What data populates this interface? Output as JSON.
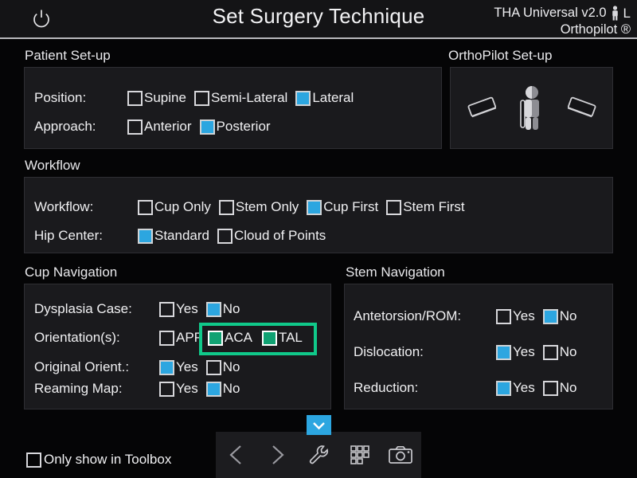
{
  "header": {
    "power_icon": "power-icon",
    "title": "Set Surgery Technique",
    "product": "THA Universal v2.0",
    "patient_icon": "person-icon",
    "laterality": "L",
    "brand": "Orthopilot ®"
  },
  "sections": {
    "patient_setup": {
      "label": "Patient Set-up",
      "rows": [
        {
          "label": "Position:",
          "options": [
            {
              "label": "Supine",
              "state": "unchecked"
            },
            {
              "label": "Semi-Lateral",
              "state": "unchecked"
            },
            {
              "label": "Lateral",
              "state": "checked-blue"
            }
          ]
        },
        {
          "label": "Approach:",
          "options": [
            {
              "label": "Anterior",
              "state": "unchecked"
            },
            {
              "label": "Posterior",
              "state": "checked-blue"
            }
          ]
        }
      ]
    },
    "orthopilot_setup": {
      "label": "OrthoPilot Set-up",
      "icons": [
        "camera-tilt-left-icon",
        "patient-figure-icon",
        "camera-tilt-right-icon"
      ]
    },
    "workflow": {
      "label": "Workflow",
      "rows": [
        {
          "label": "Workflow:",
          "options": [
            {
              "label": "Cup Only",
              "state": "unchecked"
            },
            {
              "label": "Stem Only",
              "state": "unchecked"
            },
            {
              "label": "Cup First",
              "state": "checked-blue"
            },
            {
              "label": "Stem First",
              "state": "unchecked"
            }
          ]
        },
        {
          "label": "Hip Center:",
          "options": [
            {
              "label": "Standard",
              "state": "checked-blue"
            },
            {
              "label": "Cloud of Points",
              "state": "unchecked"
            }
          ]
        }
      ]
    },
    "cup_navigation": {
      "label": "Cup Navigation",
      "rows": [
        {
          "label": "Dysplasia Case:",
          "options": [
            {
              "label": "Yes",
              "state": "unchecked"
            },
            {
              "label": "No",
              "state": "checked-blue"
            }
          ]
        },
        {
          "label": "Orientation(s):",
          "options": [
            {
              "label": "APP",
              "state": "unchecked"
            }
          ],
          "highlighted_options": [
            {
              "label": "ACA",
              "state": "checked-green"
            },
            {
              "label": "TAL",
              "state": "checked-green"
            }
          ]
        },
        {
          "label": "Original Orient.:",
          "options": [
            {
              "label": "Yes",
              "state": "checked-blue"
            },
            {
              "label": "No",
              "state": "unchecked"
            }
          ]
        },
        {
          "label": "Reaming Map:",
          "options": [
            {
              "label": "Yes",
              "state": "unchecked"
            },
            {
              "label": "No",
              "state": "checked-blue"
            }
          ]
        }
      ]
    },
    "stem_navigation": {
      "label": "Stem Navigation",
      "rows": [
        {
          "label": "Antetorsion/ROM:",
          "options": [
            {
              "label": "Yes",
              "state": "unchecked"
            },
            {
              "label": "No",
              "state": "checked-blue"
            }
          ]
        },
        {
          "label": "Dislocation:",
          "options": [
            {
              "label": "Yes",
              "state": "checked-blue"
            },
            {
              "label": "No",
              "state": "unchecked"
            }
          ]
        },
        {
          "label": "Reduction:",
          "options": [
            {
              "label": "Yes",
              "state": "checked-blue"
            },
            {
              "label": "No",
              "state": "unchecked"
            }
          ]
        }
      ]
    }
  },
  "footer": {
    "only_toolbox_label": "Only show in Toolbox",
    "only_toolbox_state": "unchecked",
    "expand_icon": "chevron-down-icon",
    "toolbar_icons": [
      "back-arrow-icon",
      "forward-arrow-icon",
      "wrench-icon",
      "keypad-grid-icon",
      "camera-icon"
    ]
  },
  "colors": {
    "accent_blue": "#2ca6e0",
    "accent_green": "#10a273",
    "highlight_green": "#10c98a",
    "panel_bg": "#1a1a1d",
    "page_bg": "#050506"
  }
}
